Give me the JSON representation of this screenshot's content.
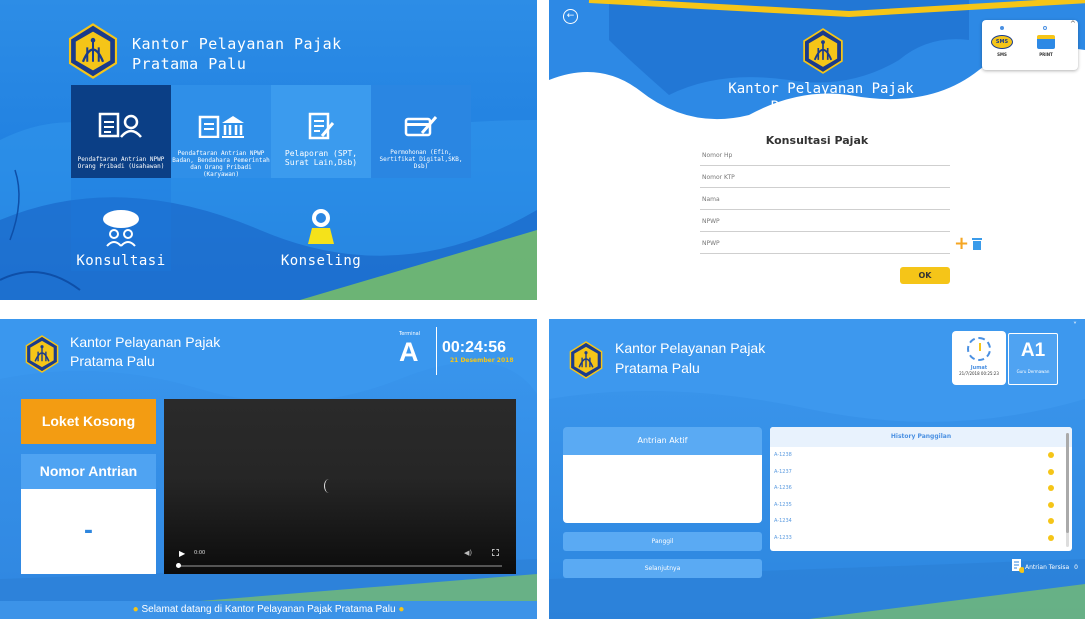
{
  "panel1": {
    "title_line1": "Kantor Pelayanan Pajak",
    "title_line2": "Pratama Palu",
    "tiles": [
      {
        "caption": "Pendaftaran Antrian NPWP Orang Pribadi (Usahawan)",
        "icon": "id-card-person-icon"
      },
      {
        "caption": "Pendaftaran Antrian NPWP Badan, Bendahara Pemerintah dan Orang Pribadi (Karyawan)",
        "icon": "id-card-bank-icon"
      },
      {
        "caption": "Pelaporan (SPT, Surat Lain,Dsb)",
        "icon": "report-edit-icon"
      },
      {
        "caption": "Permohonan (Efin, Sertifikat Digital,SKB, Dsb)",
        "icon": "card-pen-icon"
      },
      {
        "caption": "Konsultasi",
        "icon": "consultation-people-icon"
      },
      {
        "caption": "Konseling",
        "icon": "counseling-person-icon"
      }
    ]
  },
  "panel2": {
    "title_line1": "Kantor Pelayanan Pajak",
    "title_line2": "Pratama Palu",
    "heading": "Konsultasi Pajak",
    "fields": [
      {
        "placeholder": "Nomor Hp"
      },
      {
        "placeholder": "Nomor KTP"
      },
      {
        "placeholder": "Nama"
      },
      {
        "placeholder": "NPWP"
      },
      {
        "placeholder": "NPWP"
      }
    ],
    "ok_label": "OK",
    "popup": {
      "sms_label": "SMS",
      "print_label": "PRINT"
    }
  },
  "panel3": {
    "title_line1": "Kantor Pelayanan Pajak",
    "title_line2": "Pratama Palu",
    "terminal_label": "Terminal",
    "terminal_value": "A",
    "clock": "00:24:56",
    "date": "21 Desember 2018",
    "loket_label": "Loket Kosong",
    "nomor_label": "Nomor Antrian",
    "nomor_value": "-",
    "video_time": "0:00",
    "footer_text": "Selamat datang di Kantor Pelayanan Pajak Pratama Palu"
  },
  "panel4": {
    "title_line1": "Kantor Pelayanan Pajak",
    "title_line2": "Pratama Palu",
    "clock_day": "Jumat",
    "clock_date": "21/7/2018 00:25:23",
    "queue_code": "A1",
    "queue_sub": "Guru Dermawan",
    "aktif_label": "Antrian Aktif",
    "panggil_label": "Panggil",
    "selanjutnya_label": "Selanjutnya",
    "history_label": "History Panggilan",
    "history": [
      "A-1238",
      "A-1237",
      "A-1236",
      "A-1235",
      "A-1234",
      "A-1233"
    ],
    "tersisa_label": "Antrian Tersisa",
    "tersisa_value": "0"
  }
}
